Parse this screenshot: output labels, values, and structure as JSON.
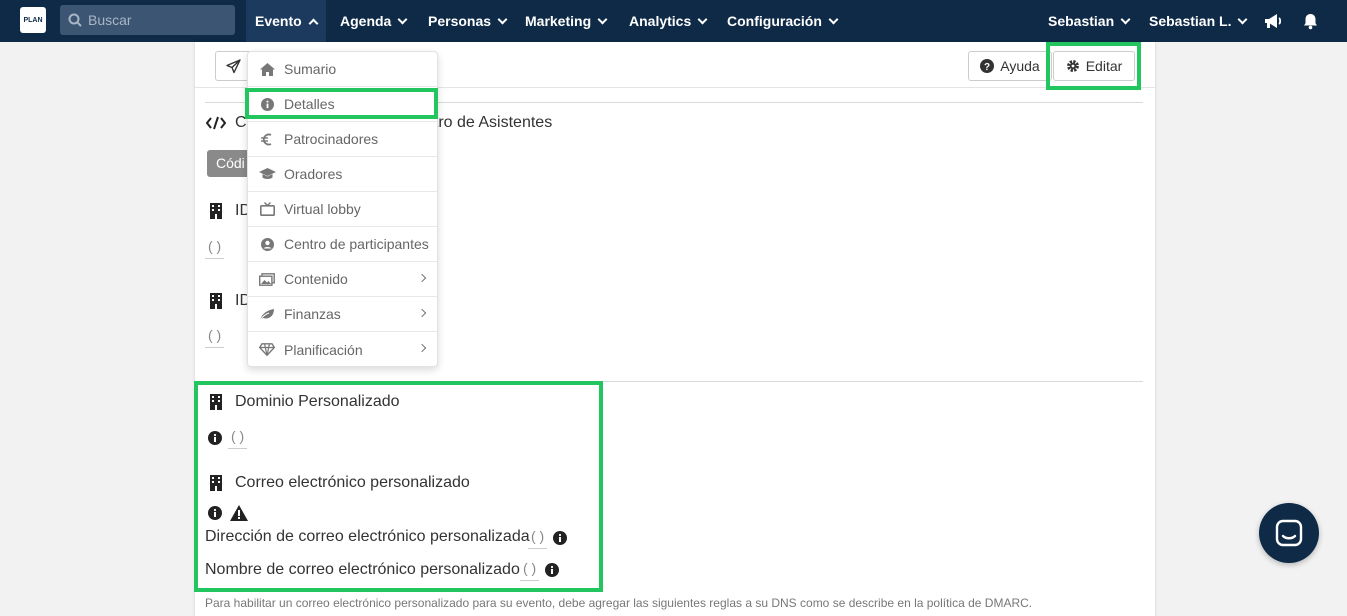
{
  "logo": {
    "text": "PLAN"
  },
  "search": {
    "placeholder": "Buscar"
  },
  "nav": {
    "evento": "Evento",
    "agenda": "Agenda",
    "personas": "Personas",
    "marketing": "Marketing",
    "analytics": "Analytics",
    "configuracion": "Configuración",
    "user1": "Sebastian",
    "user2": "Sebastian L."
  },
  "toolbar": {
    "help_label": "Ayuda",
    "edit_label": "Editar"
  },
  "content": {
    "code_section_prefix": "C",
    "code_section_suffix": "ntro de Asistentes",
    "code_tab": "Códi",
    "id_label_1": "ID",
    "id_value_1": "( )",
    "id_label_2": "ID",
    "id_value_2": "( )",
    "custom_domain_title": "Dominio Personalizado",
    "custom_domain_value": "( )",
    "custom_email_title": "Correo electrónico personalizado",
    "custom_email_address_label": "Dirección de correo electrónico personalizada",
    "custom_email_address_value": "( )",
    "custom_email_name_label": "Nombre de correo electrónico personalizado",
    "custom_email_name_value": "( )",
    "footnote": "Para habilitar un correo electrónico personalizado para su evento, debe agregar las siguientes reglas a su DNS como se describe en la política de DMARC."
  },
  "dropdown": {
    "items": [
      {
        "label": "Sumario",
        "icon": "home-icon"
      },
      {
        "label": "Detalles",
        "icon": "info-circle-icon"
      },
      {
        "label": "Patrocinadores",
        "icon": "euro-icon"
      },
      {
        "label": "Oradores",
        "icon": "graduation-cap-icon"
      },
      {
        "label": "Virtual lobby",
        "icon": "tv-icon"
      },
      {
        "label": "Centro de participantes",
        "icon": "user-circle-icon"
      },
      {
        "label": "Contenido",
        "icon": "images-icon"
      },
      {
        "label": "Finanzas",
        "icon": "leaf-icon"
      },
      {
        "label": "Planificación",
        "icon": "diamond-icon"
      }
    ]
  },
  "colors": {
    "navbar": "#0e2a47",
    "highlight": "#22c55e"
  }
}
